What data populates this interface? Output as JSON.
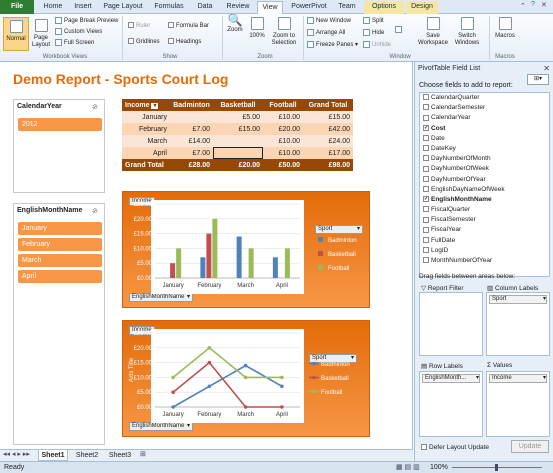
{
  "ribbon_tabs": [
    {
      "label": "File"
    },
    {
      "label": "Home"
    },
    {
      "label": "Insert"
    },
    {
      "label": "Page Layout"
    },
    {
      "label": "Formulas"
    },
    {
      "label": "Data"
    },
    {
      "label": "Review"
    },
    {
      "label": "View"
    },
    {
      "label": "PowerPivot"
    },
    {
      "label": "Team"
    },
    {
      "label": "Options"
    },
    {
      "label": "Design"
    }
  ],
  "ribbon": {
    "normal": "Normal",
    "page_layout": "Page Layout",
    "page_break_preview": "Page Break Preview",
    "custom_views": "Custom Views",
    "full_screen": "Full Screen",
    "group_workbook_views": "Workbook Views",
    "ruler": "Ruler",
    "formula_bar": "Formula Bar",
    "gridlines": "Gridlines",
    "headings": "Headings",
    "group_show": "Show",
    "zoom": "Zoom",
    "zoom_100": "100%",
    "zoom_to_selection": "Zoom to Selection",
    "group_zoom": "Zoom",
    "new_window": "New Window",
    "arrange_all": "Arrange All",
    "freeze_panes": "Freeze Panes",
    "split": "Split",
    "hide": "Hide",
    "unhide": "Unhide",
    "save_workspace": "Save Workspace",
    "switch_windows": "Switch Windows",
    "group_window": "Window",
    "macros": "Macros",
    "group_macros": "Macros"
  },
  "report": {
    "title": "Demo Report - Sports Court Log"
  },
  "slicer_year": {
    "header": "CalendarYear",
    "items": [
      "2012"
    ]
  },
  "slicer_month": {
    "header": "EnglishMonthName",
    "items": [
      "January",
      "February",
      "March",
      "April"
    ]
  },
  "pivot": {
    "headers": [
      "Income",
      "Badminton",
      "Basketball",
      "Football",
      "Grand Total"
    ],
    "rows": [
      {
        "label": "January",
        "cells": [
          "",
          "£5.00",
          "£10.00",
          "£15.00"
        ]
      },
      {
        "label": "February",
        "cells": [
          "£7.00",
          "£15.00",
          "£20.00",
          "£42.00"
        ]
      },
      {
        "label": "March",
        "cells": [
          "£14.00",
          "",
          "£10.00",
          "£24.00"
        ]
      },
      {
        "label": "April",
        "cells": [
          "£7.00",
          "",
          "£10.00",
          "£17.00"
        ]
      }
    ],
    "total": {
      "label": "Grand Total",
      "cells": [
        "£28.00",
        "£20.00",
        "£50.00",
        "£98.00"
      ]
    }
  },
  "chart_data": [
    {
      "type": "bar",
      "field_button": "Income",
      "axis_button": "EnglishMonthName",
      "legend_button": "Sport",
      "categories": [
        "January",
        "February",
        "March",
        "April"
      ],
      "series": [
        {
          "name": "Badminton",
          "values": [
            0,
            7,
            14,
            7
          ]
        },
        {
          "name": "Basketball",
          "values": [
            5,
            15,
            0,
            0
          ]
        },
        {
          "name": "Football",
          "values": [
            10,
            20,
            10,
            10
          ]
        }
      ],
      "y_ticks": [
        "£0.00",
        "£5.00",
        "£10.00",
        "£15.00",
        "£20.00",
        "£25.00"
      ],
      "ylim": [
        0,
        25
      ],
      "legend_position": "right",
      "colors": {
        "Badminton": "#4f81bd",
        "Basketball": "#c0504d",
        "Football": "#9bbb59"
      }
    },
    {
      "type": "line",
      "field_button": "Income",
      "axis_button": "EnglishMonthName",
      "legend_button": "Sport",
      "ylabel": "Axis Title",
      "categories": [
        "January",
        "February",
        "March",
        "April"
      ],
      "series": [
        {
          "name": "Badminton",
          "values": [
            0,
            7,
            14,
            7
          ]
        },
        {
          "name": "Basketball",
          "values": [
            5,
            15,
            0,
            0
          ]
        },
        {
          "name": "Football",
          "values": [
            10,
            20,
            10,
            10
          ]
        }
      ],
      "y_ticks": [
        "£0.00",
        "£5.00",
        "£10.00",
        "£15.00",
        "£20.00",
        "£25.00"
      ],
      "ylim": [
        0,
        25
      ],
      "legend_position": "right",
      "colors": {
        "Badminton": "#4f81bd",
        "Basketball": "#c0504d",
        "Football": "#9bbb59"
      }
    }
  ],
  "sheet_tabs": [
    "Sheet1",
    "Sheet2",
    "Sheet3"
  ],
  "status": {
    "ready": "Ready",
    "zoom": "100%"
  },
  "field_list": {
    "title": "PivotTable Field List",
    "choose_label": "Choose fields to add to report:",
    "fields": [
      {
        "name": "CalendarQuarter",
        "checked": false
      },
      {
        "name": "CalendarSemester",
        "checked": false
      },
      {
        "name": "CalendarYear",
        "checked": false
      },
      {
        "name": "Cost",
        "checked": true
      },
      {
        "name": "Date",
        "checked": false
      },
      {
        "name": "DateKey",
        "checked": false
      },
      {
        "name": "DayNumberOfMonth",
        "checked": false
      },
      {
        "name": "DayNumberOfWeek",
        "checked": false
      },
      {
        "name": "DayNumberOfYear",
        "checked": false
      },
      {
        "name": "EnglishDayNameOfWeek",
        "checked": false
      },
      {
        "name": "EnglishMonthName",
        "checked": true
      },
      {
        "name": "FiscalQuarter",
        "checked": false
      },
      {
        "name": "FiscalSemester",
        "checked": false
      },
      {
        "name": "FiscalYear",
        "checked": false
      },
      {
        "name": "FullDate",
        "checked": false
      },
      {
        "name": "LogID",
        "checked": false
      },
      {
        "name": "MonthNumberOfYear",
        "checked": false
      }
    ],
    "drag_label": "Drag fields between areas below:",
    "report_filter": "Report Filter",
    "column_labels": "Column Labels",
    "column_value": "Sport",
    "row_labels": "Row Labels",
    "row_value": "EnglishMonth...",
    "values_label": "Values",
    "values_value": "Income",
    "defer": "Defer Layout Update",
    "update": "Update"
  }
}
